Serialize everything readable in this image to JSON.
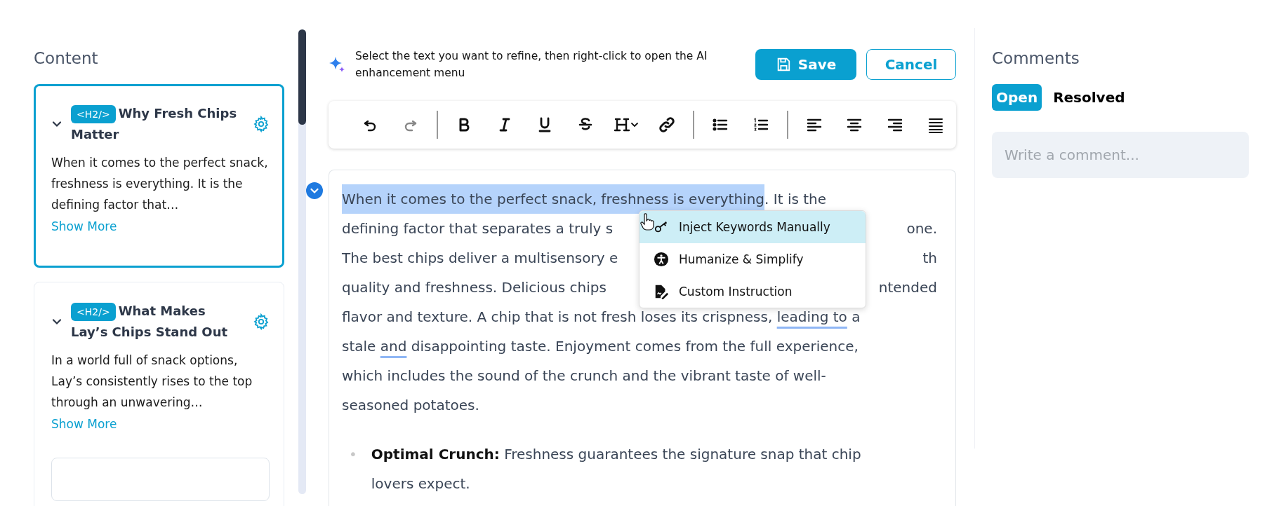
{
  "sidebar": {
    "title": "Content",
    "sections": [
      {
        "badge": "<H2/>",
        "title": "Why Fresh Chips Matter",
        "excerpt": "When it comes to the perfect snack, freshness is everything. It is the defining factor that…",
        "link": "Show More",
        "selected": true
      },
      {
        "badge": "<H2/>",
        "title": "What Makes Lay’s Chips Stand Out",
        "excerpt": "In a world full of snack options, Lay’s consistently rises to the top through an unwavering…",
        "link": "Show More",
        "selected": false
      }
    ]
  },
  "editor": {
    "hint": "Select the text you want to refine, then right-click to open the AI enhancement menu",
    "buttons": [
      {
        "label": "Save",
        "kind": "primary"
      },
      {
        "label": "Cancel",
        "kind": "secondary"
      }
    ],
    "toolbar": [
      {
        "disabled": false
      },
      {
        "disabled": true
      },
      {
        "disabled": false
      },
      {
        "disabled": false
      },
      {
        "disabled": false
      },
      {
        "disabled": false
      },
      {
        "disabled": false
      },
      {
        "disabled": false
      },
      {
        "disabled": false
      },
      {
        "disabled": false
      },
      {
        "disabled": false
      },
      {
        "disabled": false
      },
      {
        "disabled": false
      },
      {
        "disabled": false
      }
    ],
    "lines": [
      {
        "segments": [
          {
            "text": "When it comes to the perfect snack, freshness is everything",
            "kind": "selected"
          },
          {
            "text": ". It is the",
            "kind": "plain"
          }
        ]
      },
      {
        "segments": [
          {
            "text": "defining factor that separates a truly s",
            "kind": "plain"
          }
        ],
        "tail": "one."
      },
      {
        "segments": [
          {
            "text": "The best chips deliver a multisensory e",
            "kind": "plain"
          }
        ],
        "tail": "th"
      },
      {
        "segments": [
          {
            "text": "quality and freshness. Delicious chips",
            "kind": "plain"
          }
        ],
        "tail": "ntended"
      },
      {
        "segments": [
          {
            "text": "flavor and texture. A chip that is not fresh loses its crispness, ",
            "kind": "plain"
          },
          {
            "text": "leading to",
            "kind": "underlined"
          },
          {
            "text": " a",
            "kind": "plain"
          }
        ]
      },
      {
        "segments": [
          {
            "text": "stale ",
            "kind": "plain"
          },
          {
            "text": "and",
            "kind": "underlined"
          },
          {
            "text": " disappointing taste. Enjoyment comes from the full experience,",
            "kind": "plain"
          }
        ]
      },
      {
        "segments": [
          {
            "text": "which includes the sound of the crunch and the vibrant taste of well-",
            "kind": "plain"
          }
        ]
      },
      {
        "segments": [
          {
            "text": "seasoned potatoes.",
            "kind": "plain"
          }
        ]
      }
    ],
    "bullets": [
      {
        "marker": "•",
        "text": "**Optimal Crunch:** Freshness guarantees the signature snap that chip lovers expect."
      }
    ],
    "menu": [
      {
        "label": "Inject Keywords Manually",
        "selected": true
      },
      {
        "label": "Humanize & Simplify",
        "selected": false
      },
      {
        "label": "Custom Instruction",
        "selected": false
      }
    ]
  },
  "comments": {
    "title": "Comments",
    "tabs": [
      {
        "label": "Open",
        "selected": true
      },
      {
        "label": "Resolved",
        "selected": false
      }
    ],
    "input": {
      "placeholder": "Write a comment..."
    }
  }
}
